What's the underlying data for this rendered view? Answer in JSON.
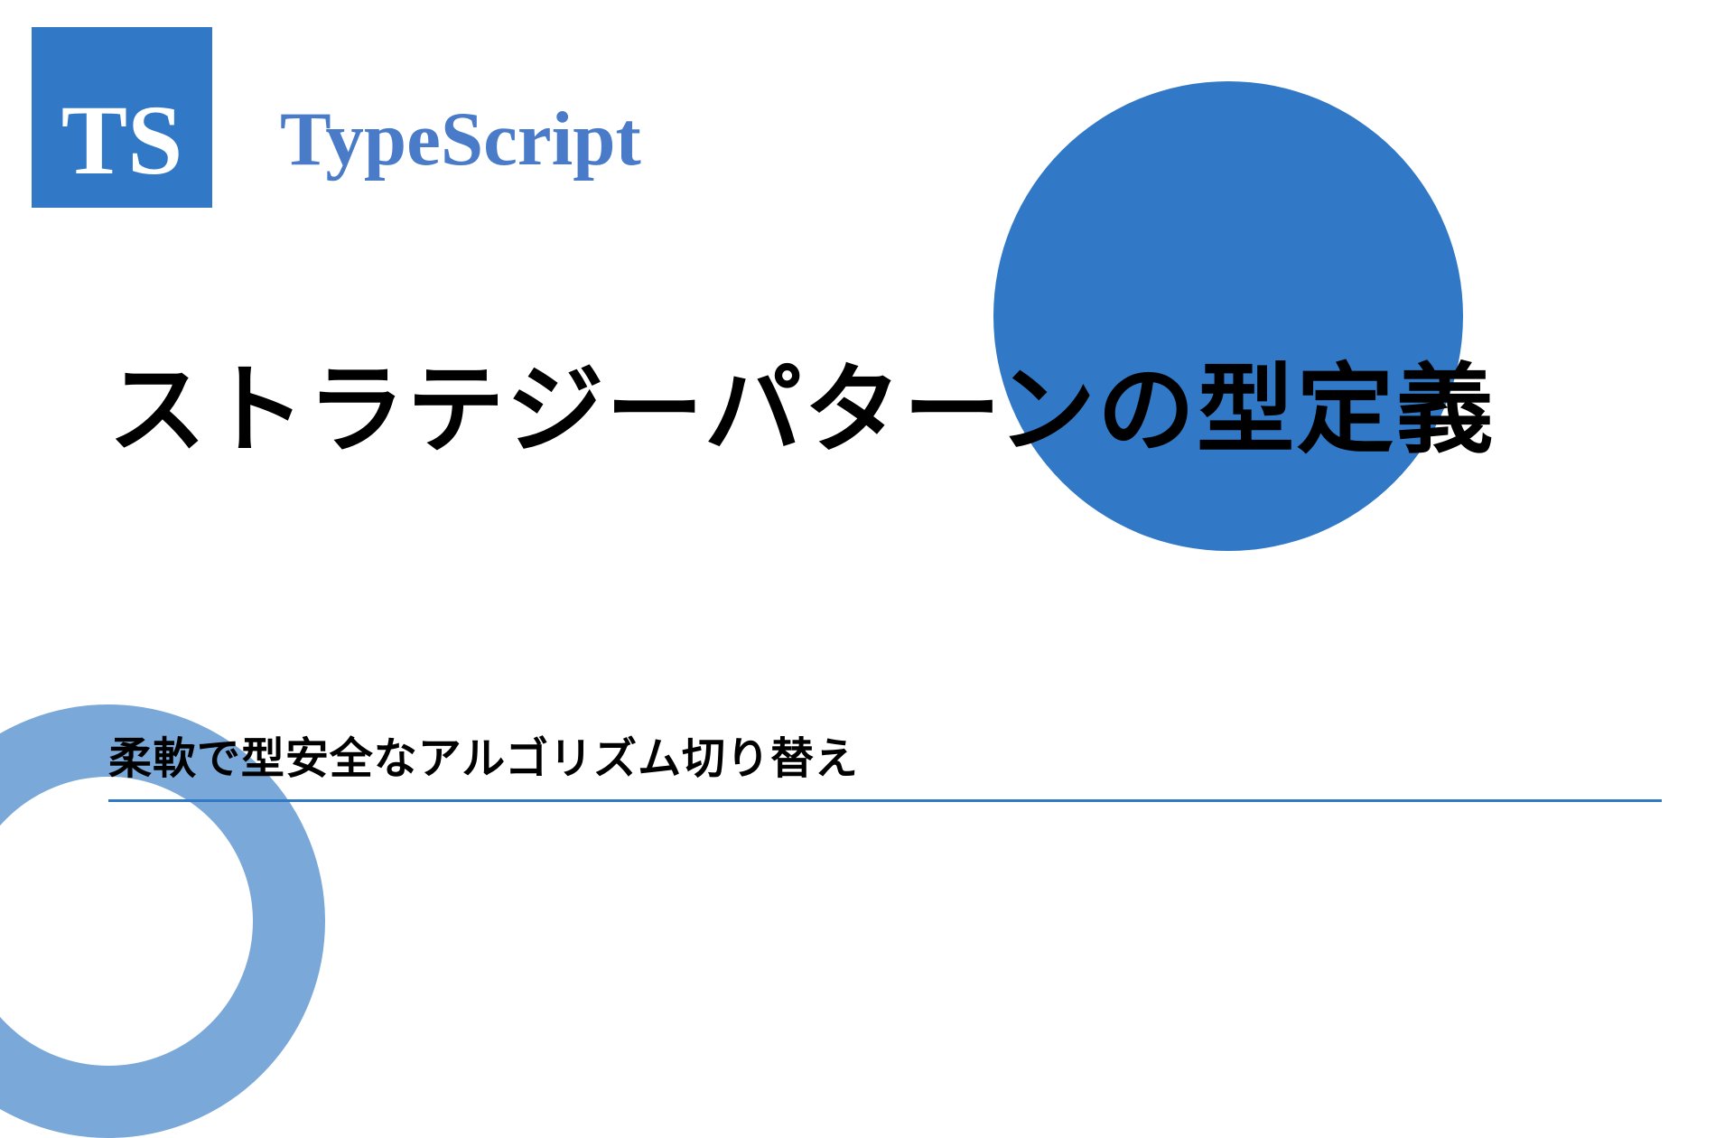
{
  "badge": {
    "text": "TS"
  },
  "header": {
    "label": "TypeScript"
  },
  "title": "ストラテジーパターンの型定義",
  "subtitle": "柔軟で型安全なアルゴリズム切り替え",
  "colors": {
    "primary": "#3178c6",
    "accent": "#4a7bc8",
    "ring": "#7aa8d8"
  }
}
